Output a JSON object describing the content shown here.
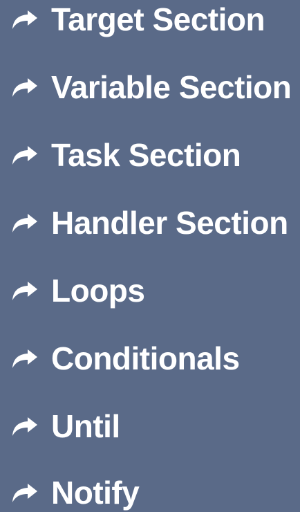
{
  "menu": {
    "items": [
      {
        "label": "Target Section",
        "icon": "share-arrow-icon"
      },
      {
        "label": "Variable Section",
        "icon": "share-arrow-icon"
      },
      {
        "label": "Task Section",
        "icon": "share-arrow-icon"
      },
      {
        "label": "Handler Section",
        "icon": "share-arrow-icon"
      },
      {
        "label": "Loops",
        "icon": "share-arrow-icon"
      },
      {
        "label": "Conditionals",
        "icon": "share-arrow-icon"
      },
      {
        "label": "Until",
        "icon": "share-arrow-icon"
      },
      {
        "label": "Notify",
        "icon": "share-arrow-icon"
      }
    ]
  },
  "colors": {
    "background": "#5a6a88",
    "text": "#ffffff"
  }
}
